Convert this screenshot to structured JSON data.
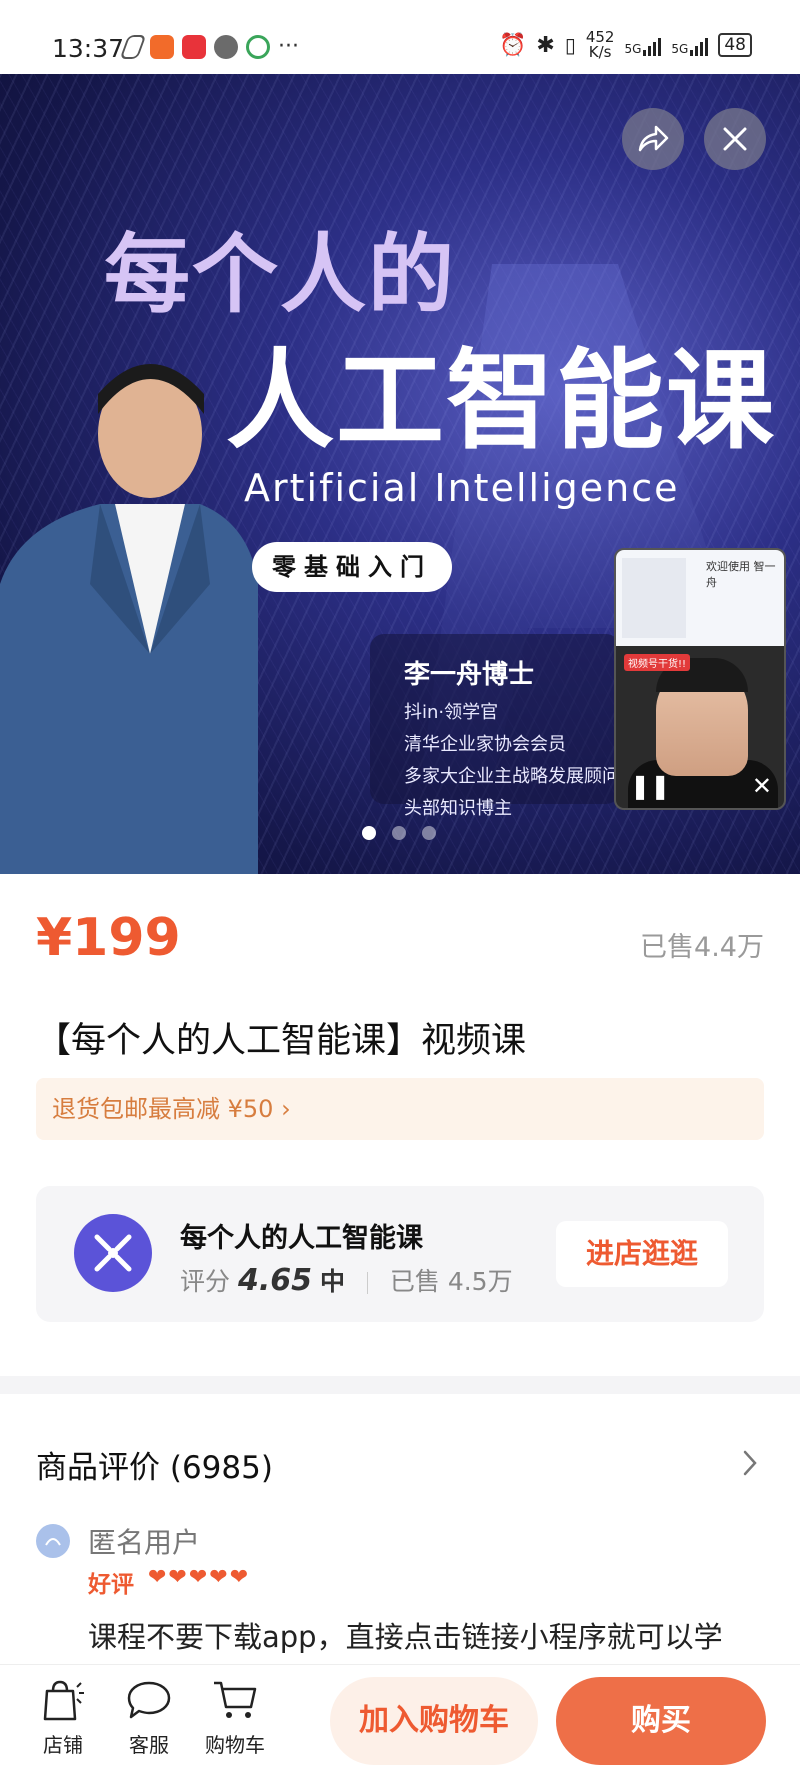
{
  "status_bar": {
    "time": "13:37",
    "net_speed_value": "452",
    "net_speed_unit": "K/s",
    "signal1": "5G",
    "signal2": "5G",
    "battery": "48"
  },
  "hero": {
    "title_line1": "每个人的",
    "title_line2": "人工智能课",
    "subtitle_en": "Artificial  Intelligence",
    "pill": "零基础入门",
    "instructor_name": "李一舟博士",
    "instructor_lines": [
      "抖in·领学官",
      "清华企业家协会会员",
      "多家大企业主战略发展顾问",
      "头部知识博主"
    ],
    "carousel_total": 3,
    "carousel_active": 1,
    "pip_header": "欢迎使用 智一舟",
    "pip_tag": "视频号干货!!"
  },
  "product": {
    "price": "¥199",
    "sold": "已售4.4万",
    "title": "【每个人的人工智能课】视频课",
    "promo": "退货包邮最高减 ¥50 ›"
  },
  "shop": {
    "name": "每个人的人工智能课",
    "score_label": "评分",
    "score": "4.65",
    "score_level": "中",
    "sold": "已售 4.5万",
    "enter_button": "进店逛逛"
  },
  "reviews": {
    "title": "商品评价 (6985)",
    "user": "匿名用户",
    "rating_label": "好评",
    "hearts": "❤❤❤❤❤",
    "text": "课程不要下载app，直接点击链接小程序就可以学"
  },
  "bottom_bar": {
    "store": "店铺",
    "service": "客服",
    "cart": "购物车",
    "add_to_cart": "加入购物车",
    "buy": "购买"
  },
  "colors": {
    "accent": "#ee5a31",
    "buy_button": "#ee6f48",
    "shop_logo": "#5b53d8"
  }
}
